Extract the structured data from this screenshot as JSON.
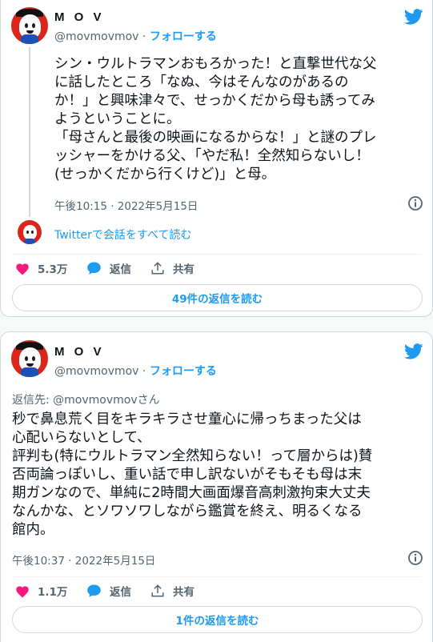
{
  "tweets": [
    {
      "user": {
        "name": "M O V",
        "handle": "@movmovmov",
        "follow_label": "フォローする",
        "separator": "·"
      },
      "text": "シン・ウルトラマンおもろかった！と直撃世代な父\nに話したところ「なぬ、今はそんなのがあるの\nか！」と興味津々で、せっかくだから母も誘ってみ\nようということに。\n「母さんと最後の映画になるからな！」と謎のプレ\nッシャーをかける父、「やだ私！全然知らないし！\n(せっかくだから行くけど)」と母。",
      "timestamp": "午後10:15 · 2022年5月15日",
      "conversation_link": "Twitterで会話をすべて読む",
      "likes": "5.3万",
      "reply_label": "返信",
      "share_label": "共有",
      "read_replies": "49件の返信を読む"
    },
    {
      "user": {
        "name": "M O V",
        "handle": "@movmovmov",
        "follow_label": "フォローする",
        "separator": "·"
      },
      "reply_to": "返信先: @movmovmovさん",
      "text": "秒で鼻息荒く目をキラキラさせ童心に帰っちまった父は\n心配いらないとして、\n評判も(特にウルトラマン全然知らない！って層からは)賛\n否両論っぽいし、重い話で申し訳ないがそもそも母は末\n期ガンなので、単純に2時間大画面爆音高刺激拘束大丈夫\nなんかな、とソワソワしながら鑑賞を終え、明るくなる\n館内。",
      "timestamp": "午後10:37 · 2022年5月15日",
      "likes": "1.1万",
      "reply_label": "返信",
      "share_label": "共有",
      "read_replies": "1件の返信を読む"
    }
  ],
  "colors": {
    "accent": "#1d9bf0",
    "like": "#f91880",
    "muted": "#536471",
    "text": "#0f1419"
  }
}
